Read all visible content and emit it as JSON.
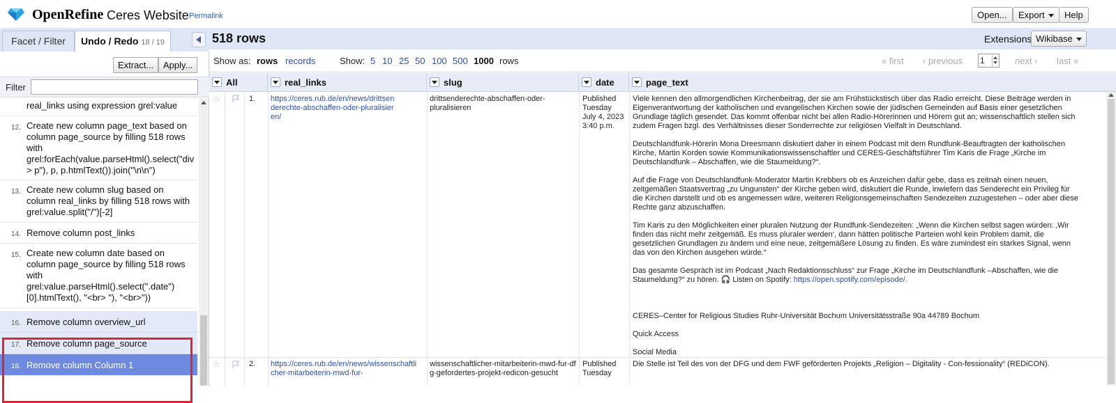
{
  "header": {
    "app_name": "OpenRefine",
    "project_name": "Ceres Website",
    "permalink": "Permalink",
    "open_label": "Open...",
    "export_label": "Export",
    "help_label": "Help"
  },
  "left_panel": {
    "tab_facet": "Facet / Filter",
    "tab_undo": "Undo / Redo",
    "undo_count": "18 / 19",
    "extract_label": "Extract...",
    "apply_label": "Apply...",
    "filter_label": "Filter",
    "filter_value": "",
    "history": [
      {
        "num": "",
        "text": "real_links using expression grel:value"
      },
      {
        "num": "12.",
        "text": "Create new column page_text based on column page_source by filling 518 rows with grel:forEach(value.parseHtml().select(\"div > p\"), p, p.htmlText()).join(\"\\n\\n\")"
      },
      {
        "num": "13.",
        "text": "Create new column slug based on column real_links by filling 518 rows with grel:value.split(\"/\")[-2]"
      },
      {
        "num": "14.",
        "text": "Remove column post_links"
      },
      {
        "num": "15.",
        "text": "Create new column date based on column page_source by filling 518 rows with grel:value.parseHtml().select(\".date\")[0].htmlText(), \"<br> \"), \"<br>\"))"
      },
      {
        "num": "16.",
        "text": "Remove column overview_url"
      },
      {
        "num": "17.",
        "text": "Remove column page_source"
      },
      {
        "num": "18.",
        "text": "Remove column Column 1"
      }
    ]
  },
  "main": {
    "rows_title": "518 rows",
    "extensions_label": "Extensions",
    "wikibase_label": "Wikibase",
    "show_as_label": "Show as:",
    "mode_rows": "rows",
    "mode_records": "records",
    "show_label": "Show:",
    "page_sizes": [
      "5",
      "10",
      "25",
      "50",
      "100",
      "500",
      "1000"
    ],
    "rows_suffix": "rows",
    "pager_first": "« first",
    "pager_prev": "‹ previous",
    "page_number": "1",
    "pager_next": "next ›",
    "pager_last": "last »",
    "columns": [
      "All",
      "real_links",
      "slug",
      "date",
      "page_text"
    ],
    "rows": [
      {
        "index": "1.",
        "real_links": "https://ceres.rub.de/en/news/drittsenderechte-abschaffen-oder-pluralisieren/",
        "slug": "drittsenderechte-abschaffen-oder-pluralisieren",
        "date": "Published Tuesday July 4, 2023 3:40 p.m.",
        "page_text": [
          "Viele kennen den allmorgendlichen Kirchenbeitrag, der sie am Frühstückstisch über das Radio erreicht. Diese Beiträge werden in Eigenverantwortung der katholischen und evangelischen Kirchen sowie der jüdischen Gemeinden auf Basis einer gesetzlichen Grundlage täglich gesendet. Das kommt offenbar nicht bei allen Radio-Hörerinnen und Hörern gut an; wissenschaftlich stellen sich zudem Fragen bzgl. des Verhältnisses dieser Sonderrechte zur religiösen Vielfalt in Deutschland.",
          "Deutschlandfunk-Hörerin Mona Dreesmann diskutiert daher in einem Podcast mit dem Rundfunk-Beauftragten der katholischen Kirche, Martin Korden sowie Kommunikationswissenschaftler und CERES-Geschäftsführer Tim Karis die Frage „Kirche im Deutschlandfunk – Abschaffen, wie die Staumeldung?“.",
          "Auf die Frage von Deutschlandfunk-Moderator Martin Krebbers ob es Anzeichen dafür gebe, dass es zeitnah einen neuen, zeitgemäßen Staatsvertrag „zu Ungunsten“ der Kirche geben wird, diskutiert die Runde, inwiefern das Senderecht ein Privileg für die Kirchen darstellt und ob es angemessen wäre, weiteren Religionsgemeinschaften Sendezeiten zuzugestehen – oder aber diese Rechte ganz abzuschaffen.",
          "Tim Karis zu den Möglichkeiten einer pluralen Nutzung der Rundfunk-Sendezeiten: „Wenn die Kirchen selbst sagen würden: ‚Wir finden das nicht mehr zeitgemäß. Es muss pluraler werden‘, dann hätten politische Parteien wohl kein Problem damit, die gesetzlichen Grundlagen zu ändern und eine neue, zeitgemäßere Lösung zu finden. Es wäre zumindest ein starkes Signal, wenn das von den Kirchen ausgehen würde.“",
          "Das gesamte Gespräch ist im Podcast „Nach Redaktionsschluss“ zur Frage „Kirche im Deutschlandfunk –Abschaffen, wie die Staumeldung?“ zu hören. 🎧 Listen on Spotify: "
        ],
        "spotify_link": "https://open.spotify.com/episode/.",
        "footer_lines": [
          "CERES–Center for Religious Studies Ruhr-Universität Bochum Universitätsstraße 90a 44789 Bochum",
          "Quick Access",
          "Social Media"
        ]
      },
      {
        "index": "2.",
        "real_links": "https://ceres.rub.de/en/news/wissenschaftlicher-mitarbeiterin-mwd-fur-",
        "slug": "wissenschaftlicher-mitarbeiterin-mwd-fur-dfg-gefordertes-projekt-redicon-gesucht",
        "date": "Published Tuesday",
        "page_text": "Die Stelle ist Teil des von der DFG und dem FWF geförderten Projekts „Religion – Digitality - Con-fessionality“ (REDiCON)."
      }
    ]
  },
  "colors": {
    "accent_blue": "#2b4fa8",
    "panel_bg": "#dfe6f6",
    "current_history": "#6d8ae0",
    "highlight_red": "#cf2a3a"
  }
}
